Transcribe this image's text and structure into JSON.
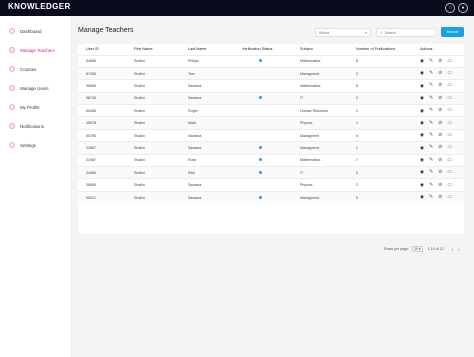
{
  "app": {
    "logo": "KNOWLEDGER"
  },
  "topbar": {
    "icons": [
      "bell-icon",
      "user-icon"
    ]
  },
  "sidebar": {
    "items": [
      {
        "label": "Dashboard",
        "icon": "home-icon",
        "active": false
      },
      {
        "label": "Manage Teachers",
        "icon": "teacher-icon",
        "active": true
      },
      {
        "label": "Courses",
        "icon": "book-icon",
        "active": false
      },
      {
        "label": "Manage Users",
        "icon": "users-icon",
        "active": false
      },
      {
        "label": "My Profile",
        "icon": "profile-icon",
        "active": false
      },
      {
        "label": "Notifications",
        "icon": "bell-icon",
        "active": false
      },
      {
        "label": "Settings",
        "icon": "gear-icon",
        "active": false
      }
    ]
  },
  "header": {
    "title": "Manage Teachers",
    "select_value": "Select",
    "search_placeholder": "Search",
    "search_button": "Search"
  },
  "table": {
    "columns": [
      "User ID",
      "First Name",
      "Last Name",
      "Verification Status",
      "Subject",
      "Number of Publications",
      "Actions"
    ],
    "rows": [
      {
        "id": "54656",
        "first": "Shalini",
        "last": "Philips",
        "verified": true,
        "subject": "Mathematics",
        "pubs": "6"
      },
      {
        "id": "87455",
        "first": "Shalini",
        "last": "Tom",
        "verified": false,
        "subject": "Managment",
        "pubs": "3"
      },
      {
        "id": "95566",
        "first": "Shalini",
        "last": "Santana",
        "verified": false,
        "subject": "Mathematics",
        "pubs": "8"
      },
      {
        "id": "98745",
        "first": "Shalini",
        "last": "Santana",
        "verified": true,
        "subject": "IT",
        "pubs": "3"
      },
      {
        "id": "65456",
        "first": "Shalini",
        "last": "Roger",
        "verified": false,
        "subject": "Human Resource",
        "pubs": "2"
      },
      {
        "id": "45678",
        "first": "Shalini",
        "last": "Mark",
        "verified": false,
        "subject": "Physics",
        "pubs": "1"
      },
      {
        "id": "65756",
        "first": "Shalini",
        "last": "Santana",
        "verified": false,
        "subject": "Managment",
        "pubs": "5"
      },
      {
        "id": "24567",
        "first": "Shalini",
        "last": "Santana",
        "verified": true,
        "subject": "Managment",
        "pubs": "2"
      },
      {
        "id": "21987",
        "first": "Shalini",
        "last": "Rose",
        "verified": true,
        "subject": "Mathematics",
        "pubs": "7"
      },
      {
        "id": "34689",
        "first": "Shalini",
        "last": "Rick",
        "verified": true,
        "subject": "IT",
        "pubs": "3"
      },
      {
        "id": "36665",
        "first": "Shalini",
        "last": "Santana",
        "verified": false,
        "subject": "Physics",
        "pubs": "2"
      },
      {
        "id": "56221",
        "first": "Shalini",
        "last": "Santana",
        "verified": true,
        "subject": "Managment",
        "pubs": "9"
      }
    ]
  },
  "pagination": {
    "rows_label": "Rows per page:",
    "rows_value": "10",
    "range": "1-10 of 12"
  },
  "colors": {
    "accent": "#19a0e8",
    "active_nav": "#c02a86",
    "topbar": "#0b0b1e",
    "verified_dot": "#2a9be0"
  }
}
